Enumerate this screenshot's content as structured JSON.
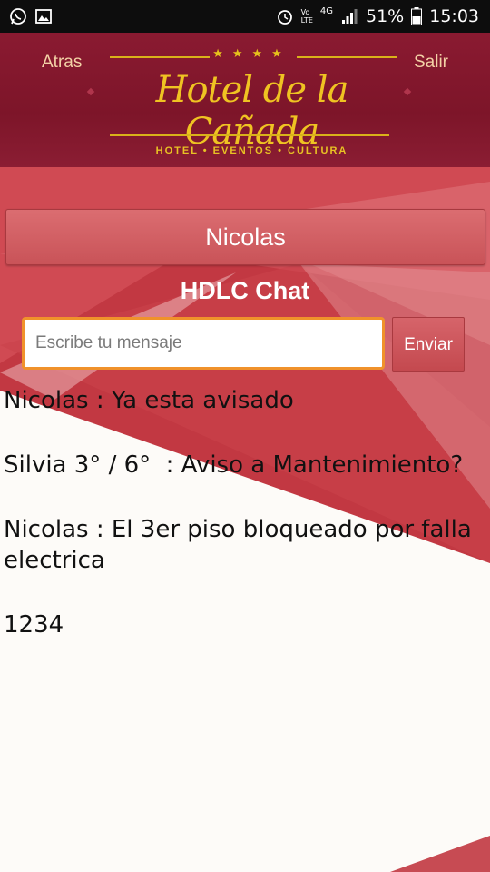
{
  "status_bar": {
    "battery": "51%",
    "time": "15:03",
    "network_top": "Vo",
    "network_bottom": "LTE",
    "signal_type": "4G",
    "icons": [
      "whatsapp-icon",
      "gallery-icon",
      "alarm-icon",
      "volte-icon",
      "signal-icon",
      "battery-icon"
    ]
  },
  "header": {
    "back_label": "Atras",
    "exit_label": "Salir",
    "logo_stars": "★★★★",
    "logo_title": "Hotel de la Cañada",
    "logo_subtitle": "HOTEL • EVENTOS • CULTURA"
  },
  "user": {
    "name": "Nicolas"
  },
  "chat": {
    "title": "HDLC Chat",
    "input_placeholder": "Escribe tu mensaje",
    "input_value": "",
    "send_label": "Enviar",
    "messages": [
      "Nicolas : Ya esta avisado",
      "Silvia 3° / 6°  : Aviso a Mantenimiento?",
      "Nicolas : El 3er piso bloqueado por falla electrica",
      "1234"
    ]
  },
  "colors": {
    "header_bg": "#7d1529",
    "accent_gold": "#efc322",
    "button_red": "#c95358",
    "input_border": "#f0922b",
    "background_red": "#c23a44"
  }
}
